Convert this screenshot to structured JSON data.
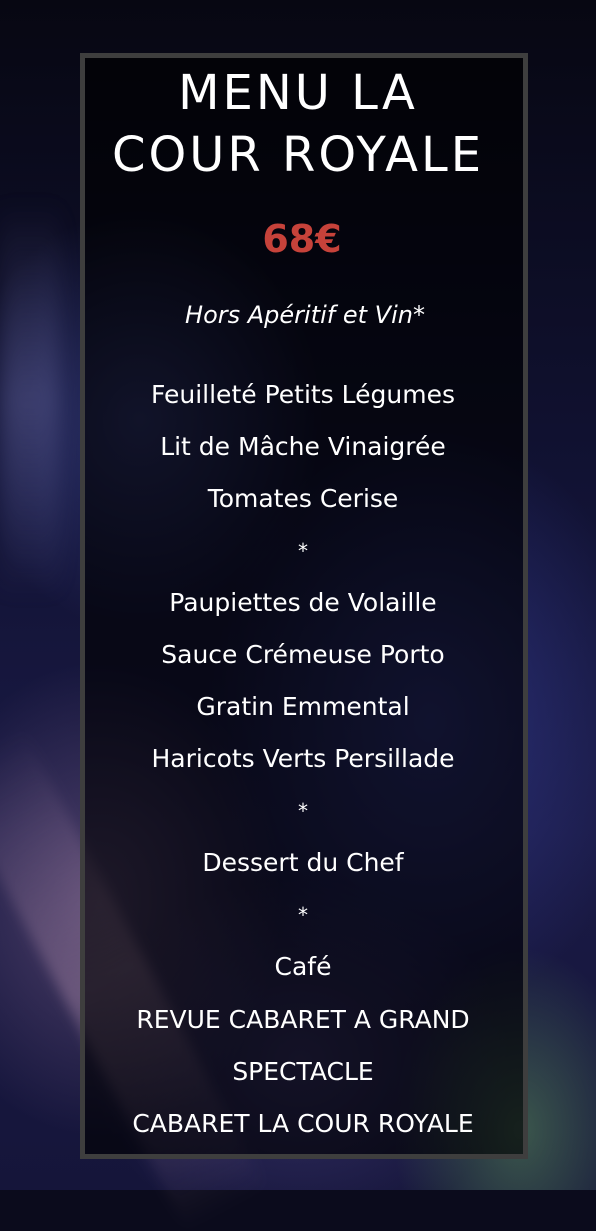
{
  "menu": {
    "title_line1": "MENU LA",
    "title_line2": "COUR ROYALE",
    "price": "68€",
    "note": "Hors Apéritif et Vin*",
    "items": [
      "Feuilleté Petits Légumes",
      "Lit de Mâche Vinaigrée",
      "Tomates Cerise",
      "*",
      "Paupiettes de Volaille",
      "Sauce Crémeuse Porto",
      "Gratin Emmental",
      "Haricots Verts Persillade",
      "*",
      "Dessert du Chef",
      "*",
      "Café"
    ],
    "show": [
      "REVUE CABARET A GRAND",
      "SPECTACLE",
      "CABARET LA COUR ROYALE"
    ],
    "price_color": "#c6423a",
    "frame_color": "#3e3e3e"
  }
}
